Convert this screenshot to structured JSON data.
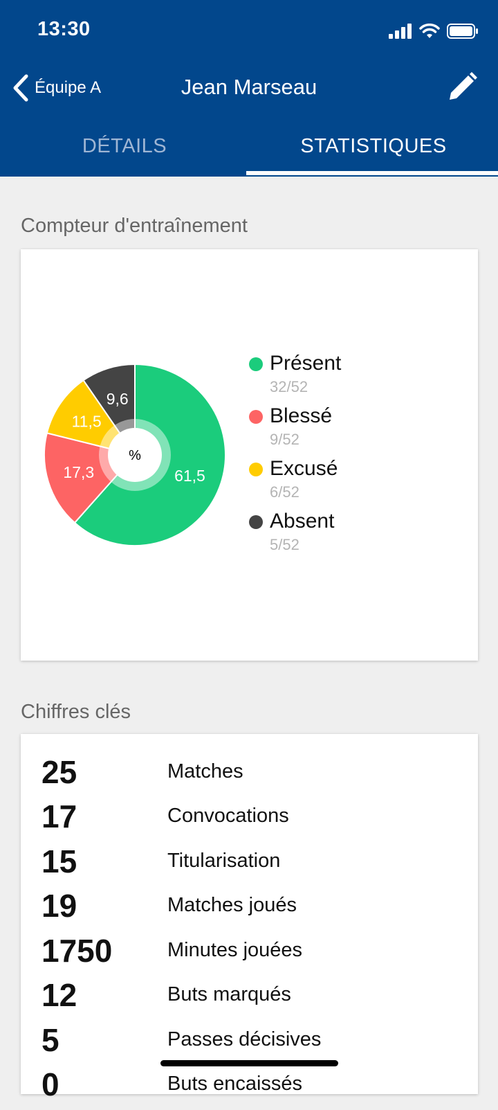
{
  "status_bar": {
    "time": "13:30"
  },
  "nav": {
    "back_label": "Équipe A",
    "title": "Jean Marseau"
  },
  "tabs": [
    {
      "label": "DÉTAILS",
      "active": false
    },
    {
      "label": "STATISTIQUES",
      "active": true
    }
  ],
  "training": {
    "section_title": "Compteur d'entraînement",
    "center_label": "%",
    "legend": [
      {
        "name": "Présent",
        "count": "32/52"
      },
      {
        "name": "Blessé",
        "count": "9/52"
      },
      {
        "name": "Excusé",
        "count": "6/52"
      },
      {
        "name": "Absent",
        "count": "5/52"
      }
    ]
  },
  "chart_data": {
    "type": "pie",
    "categories": [
      "Présent",
      "Blessé",
      "Excusé",
      "Absent"
    ],
    "values": [
      61.5,
      17.3,
      11.5,
      9.6
    ],
    "labels": [
      "61,5",
      "17,3",
      "11,5",
      "9,6"
    ],
    "colors": [
      "#1bcc7c",
      "#fd6464",
      "#ffcc00",
      "#444444"
    ],
    "unit": "%"
  },
  "key_figures": {
    "section_title": "Chiffres clés",
    "rows": [
      {
        "value": "25",
        "label": "Matches"
      },
      {
        "value": "17",
        "label": "Convocations"
      },
      {
        "value": "15",
        "label": "Titularisation"
      },
      {
        "value": "19",
        "label": "Matches joués"
      },
      {
        "value": "1750",
        "label": "Minutes jouées"
      },
      {
        "value": "12",
        "label": "Buts marqués"
      },
      {
        "value": "5",
        "label": "Passes décisives"
      },
      {
        "value": "0",
        "label": "Buts encaissés"
      }
    ]
  },
  "icons": {
    "signal": "signal-icon",
    "wifi": "wifi-icon",
    "battery": "battery-icon",
    "back": "chevron-left-icon",
    "edit": "pencil-icon"
  }
}
